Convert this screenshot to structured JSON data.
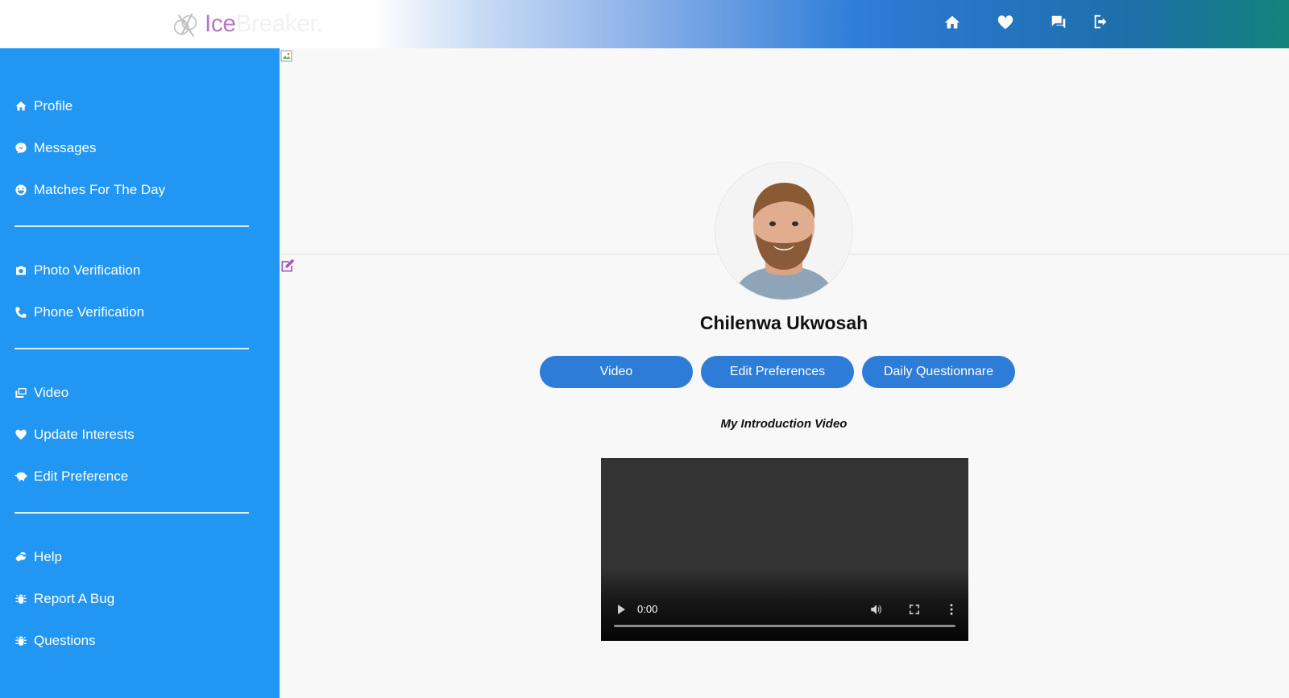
{
  "header": {
    "logo_part1": "Ice",
    "logo_part2": "Breaker.",
    "nav": [
      {
        "name": "home-icon"
      },
      {
        "name": "heart-icon"
      },
      {
        "name": "chat-icon"
      },
      {
        "name": "logout-icon"
      }
    ]
  },
  "sidebar": {
    "group1": [
      {
        "label": "Profile",
        "icon": "home-icon"
      },
      {
        "label": "Messages",
        "icon": "messenger-icon"
      },
      {
        "label": "Matches For The Day",
        "icon": "smile-icon"
      }
    ],
    "group2": [
      {
        "label": "Photo Verification",
        "icon": "camera-icon"
      },
      {
        "label": "Phone Verification",
        "icon": "phone-icon"
      }
    ],
    "group3": [
      {
        "label": "Video",
        "icon": "photo-video-icon"
      },
      {
        "label": "Update Interests",
        "icon": "heartbeat-icon"
      },
      {
        "label": "Edit Preference",
        "icon": "piggy-bank-icon"
      }
    ],
    "group4": [
      {
        "label": "Help",
        "icon": "hands-helping-icon"
      },
      {
        "label": "Report A Bug",
        "icon": "bug-icon"
      },
      {
        "label": "Questions",
        "icon": "bug-icon"
      }
    ]
  },
  "profile": {
    "name": "Chilenwa Ukwosah",
    "buttons": {
      "video": "Video",
      "edit_preferences": "Edit Preferences",
      "daily_questionnaire": "Daily Questionnare"
    },
    "intro_title": "My Introduction Video"
  },
  "video_player": {
    "time": "0:00"
  },
  "colors": {
    "sidebar": "#2196f3",
    "button": "#2d7cd8",
    "logo_accent": "#b678c8"
  }
}
